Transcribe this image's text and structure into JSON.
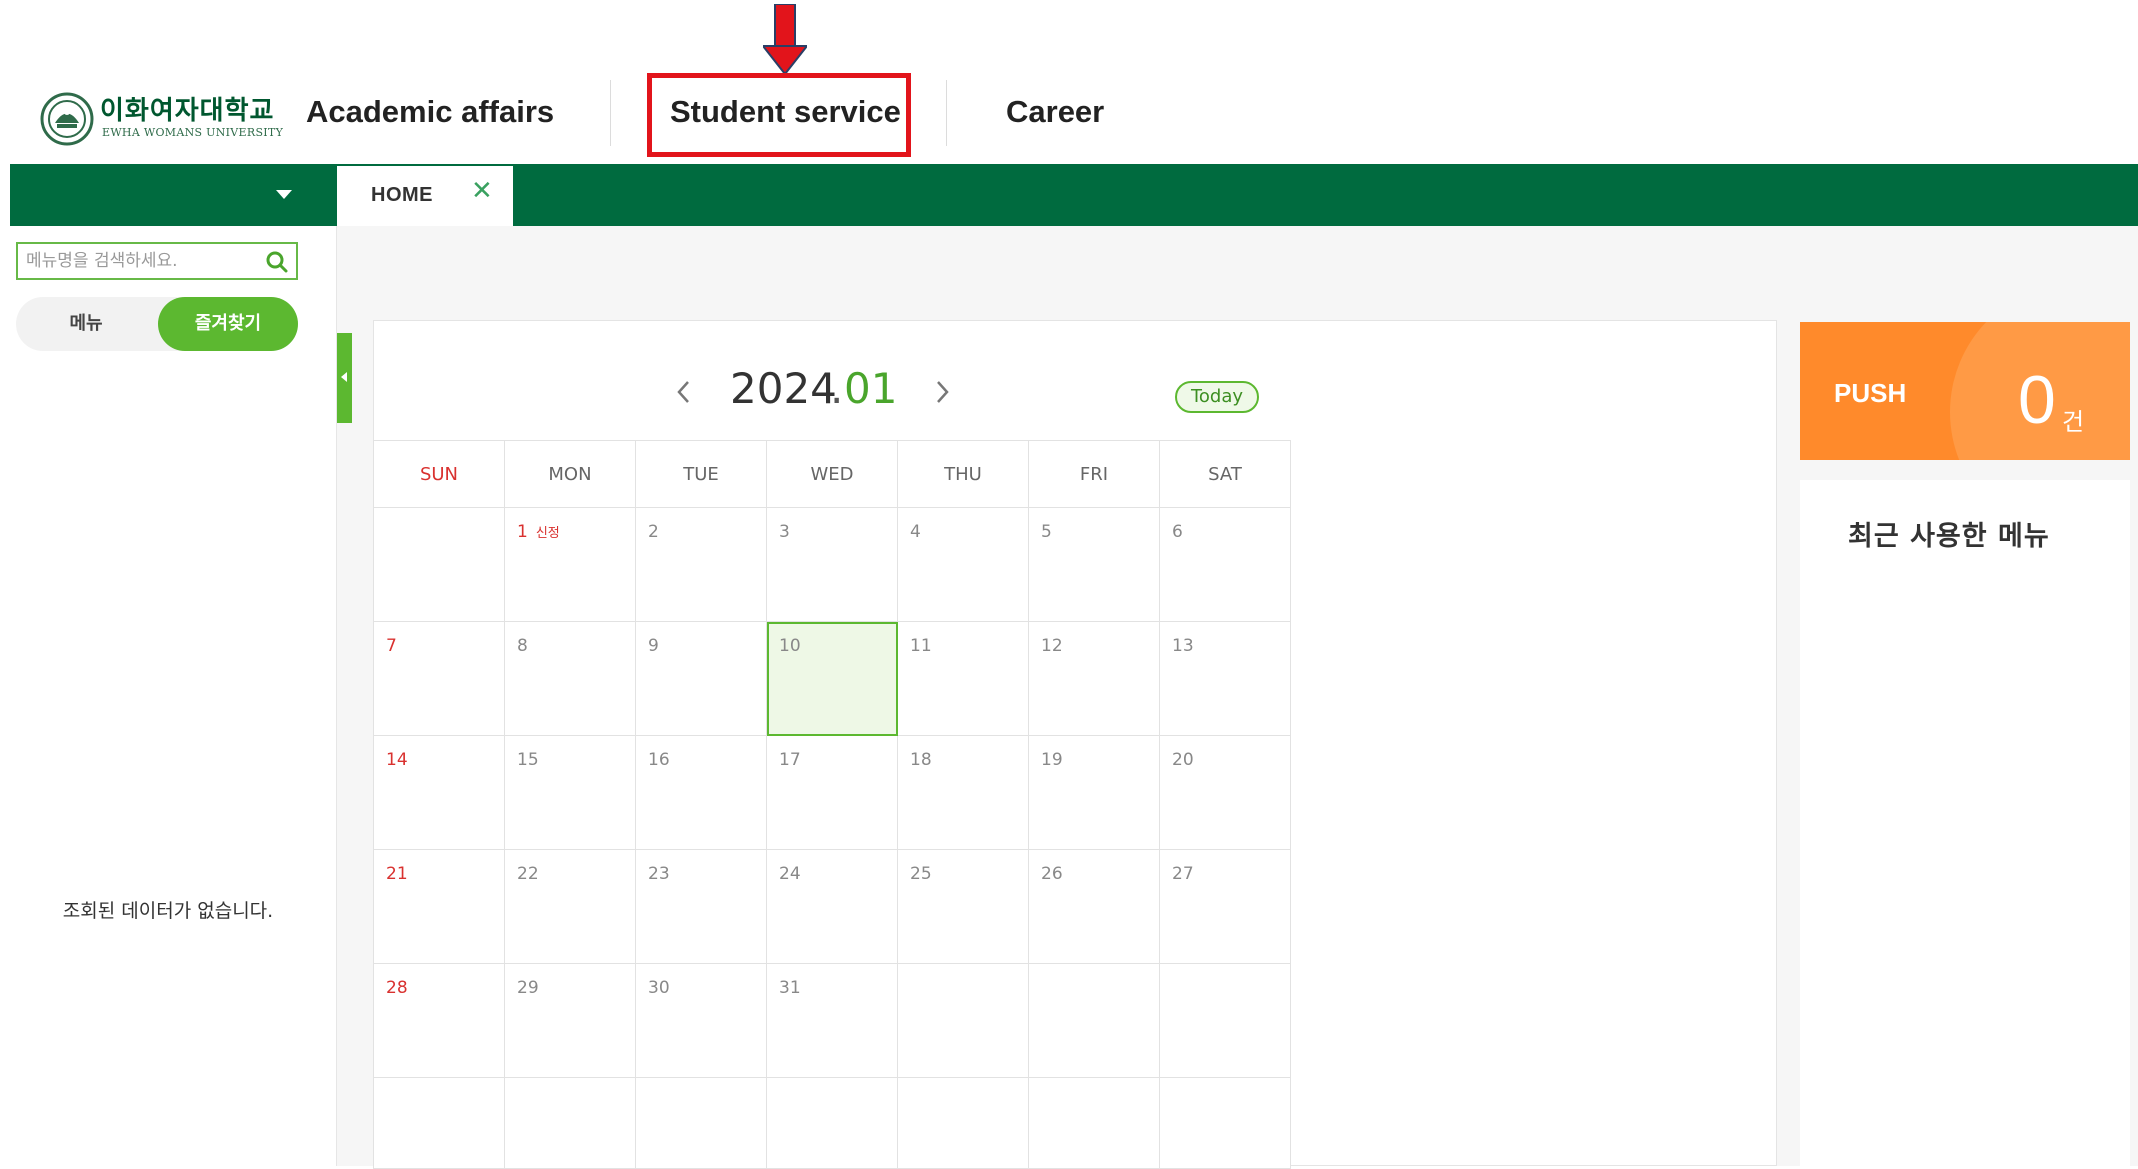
{
  "header": {
    "logo": {
      "name_kr": "이화여자대학교",
      "name_en": "EWHA WOMANS UNIVERSITY"
    },
    "nav": [
      {
        "label": "Academic affairs"
      },
      {
        "label": "Student service"
      },
      {
        "label": "Career"
      }
    ]
  },
  "tabs": [
    {
      "label": "HOME",
      "close": "✕"
    }
  ],
  "sidebar": {
    "search_placeholder": "메뉴명을 검색하세요.",
    "toggle_menu": "메뉴",
    "toggle_favorites": "즐겨찾기",
    "empty_message": "조회된 데이터가 없습니다."
  },
  "calendar": {
    "year": "2024",
    "separator": ".",
    "month": "01",
    "today_label": "Today",
    "weekdays": [
      "SUN",
      "MON",
      "TUE",
      "WED",
      "THU",
      "FRI",
      "SAT"
    ],
    "weeks": [
      [
        "",
        "1",
        "2",
        "3",
        "4",
        "5",
        "6"
      ],
      [
        "7",
        "8",
        "9",
        "10",
        "11",
        "12",
        "13"
      ],
      [
        "14",
        "15",
        "16",
        "17",
        "18",
        "19",
        "20"
      ],
      [
        "21",
        "22",
        "23",
        "24",
        "25",
        "26",
        "27"
      ],
      [
        "28",
        "29",
        "30",
        "31",
        "",
        "",
        ""
      ]
    ],
    "event_label": "신정",
    "selected_day": "10"
  },
  "push": {
    "label": "PUSH",
    "count": "0",
    "unit": "건"
  },
  "recent": {
    "title": "최근 사용한 메뉴"
  },
  "colors": {
    "brand_green": "#006b3f",
    "accent_green": "#5cb830",
    "push_orange": "#ff8a2b",
    "annotation_red": "#e2141b"
  },
  "icons": [
    "ewha-emblem-icon",
    "down-arrow-annotation-icon",
    "caret-down-icon",
    "close-icon",
    "search-icon",
    "chevron-left-icon",
    "chevron-right-icon"
  ]
}
